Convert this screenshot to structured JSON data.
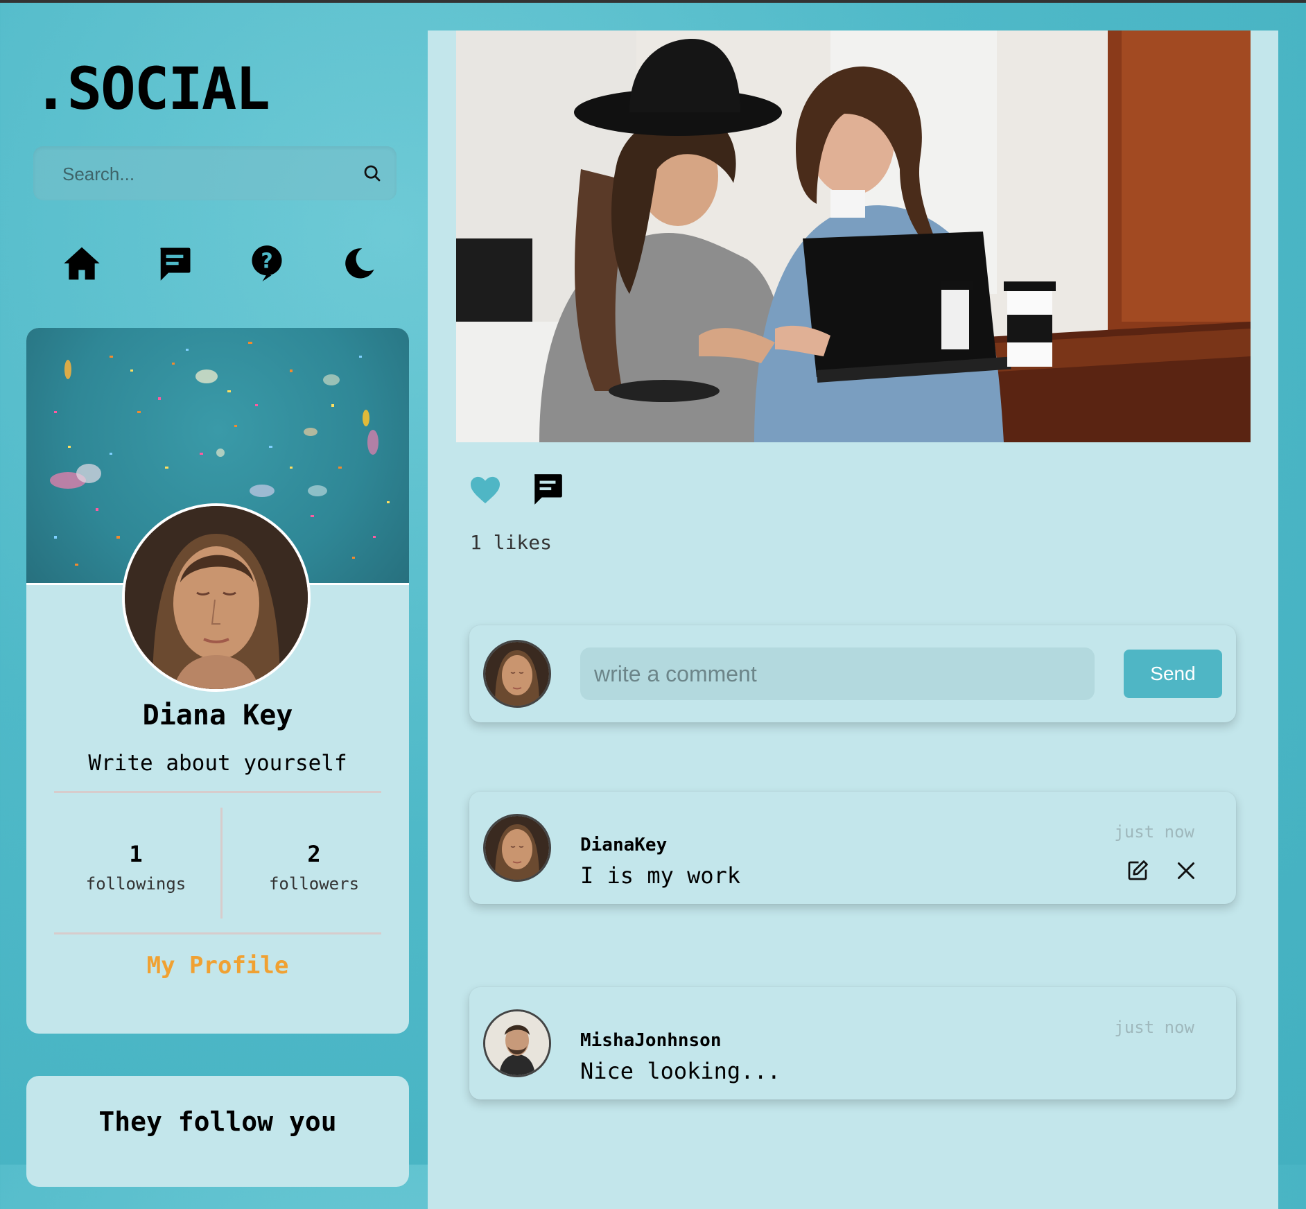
{
  "app": {
    "logo": ".SOCIAL"
  },
  "search": {
    "placeholder": "Search..."
  },
  "nav": {
    "icons": [
      "home-icon",
      "chat-icon",
      "help-icon",
      "moon-icon"
    ]
  },
  "profile": {
    "name": "Diana Key",
    "bio": "Write about yourself",
    "followings_count": "1",
    "followings_label": "followings",
    "followers_count": "2",
    "followers_label": "followers",
    "link_label": "My Profile"
  },
  "follow_section": {
    "title": "They follow you"
  },
  "post": {
    "likes_text": "1 likes",
    "comment_placeholder": "write a comment",
    "send_label": "Send",
    "comments": [
      {
        "user": "DianaKey",
        "text": "I is my work",
        "time": "just now"
      },
      {
        "user": "MishaJonhnson",
        "text": "Nice looking...",
        "time": "just now"
      }
    ]
  },
  "colors": {
    "accent": "#4fb6c5",
    "link": "#f0a132",
    "card": "#c3e6eb",
    "background": "#4fb9c8"
  }
}
